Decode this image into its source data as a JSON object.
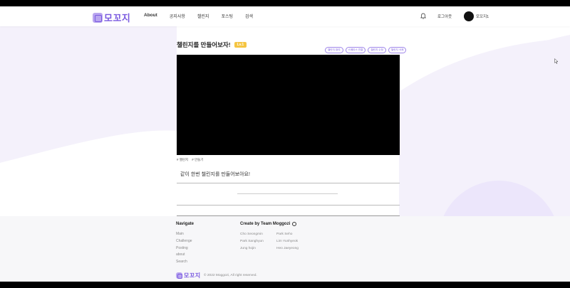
{
  "header": {
    "logo": "모꼬지",
    "nav": [
      "About",
      "공지사항",
      "챌린지",
      "포스팅",
      "검색"
    ],
    "logout": "로그아웃",
    "username": "모꼬지1"
  },
  "challenge": {
    "title": "챌린지를 만들어보자!",
    "level": "Lv.1",
    "tags": [
      "챌린지 참여",
      "스페이스 연결",
      "챌린지 수정",
      "챌린지 삭제"
    ],
    "hashtags": [
      "# 챌린지",
      "# 만들기"
    ],
    "description": "같이 한번 챌린지를 만들어보아요!"
  },
  "footer": {
    "navigate_title": "Navigate",
    "navigate_links": [
      "Main",
      "Challenge",
      "Posting",
      "about",
      "Search"
    ],
    "team_title": "Create by Team Moggozi",
    "members_col1": [
      "Cho Seongmin",
      "Park Sanghyun",
      "Jung hojin"
    ],
    "members_col2": [
      "Park Seho",
      "Lim Yunhyeok",
      "Heo Jaeyeong"
    ],
    "logo": "모꼬지",
    "copyright": "© 2022 Moggozi, All right reserved."
  }
}
